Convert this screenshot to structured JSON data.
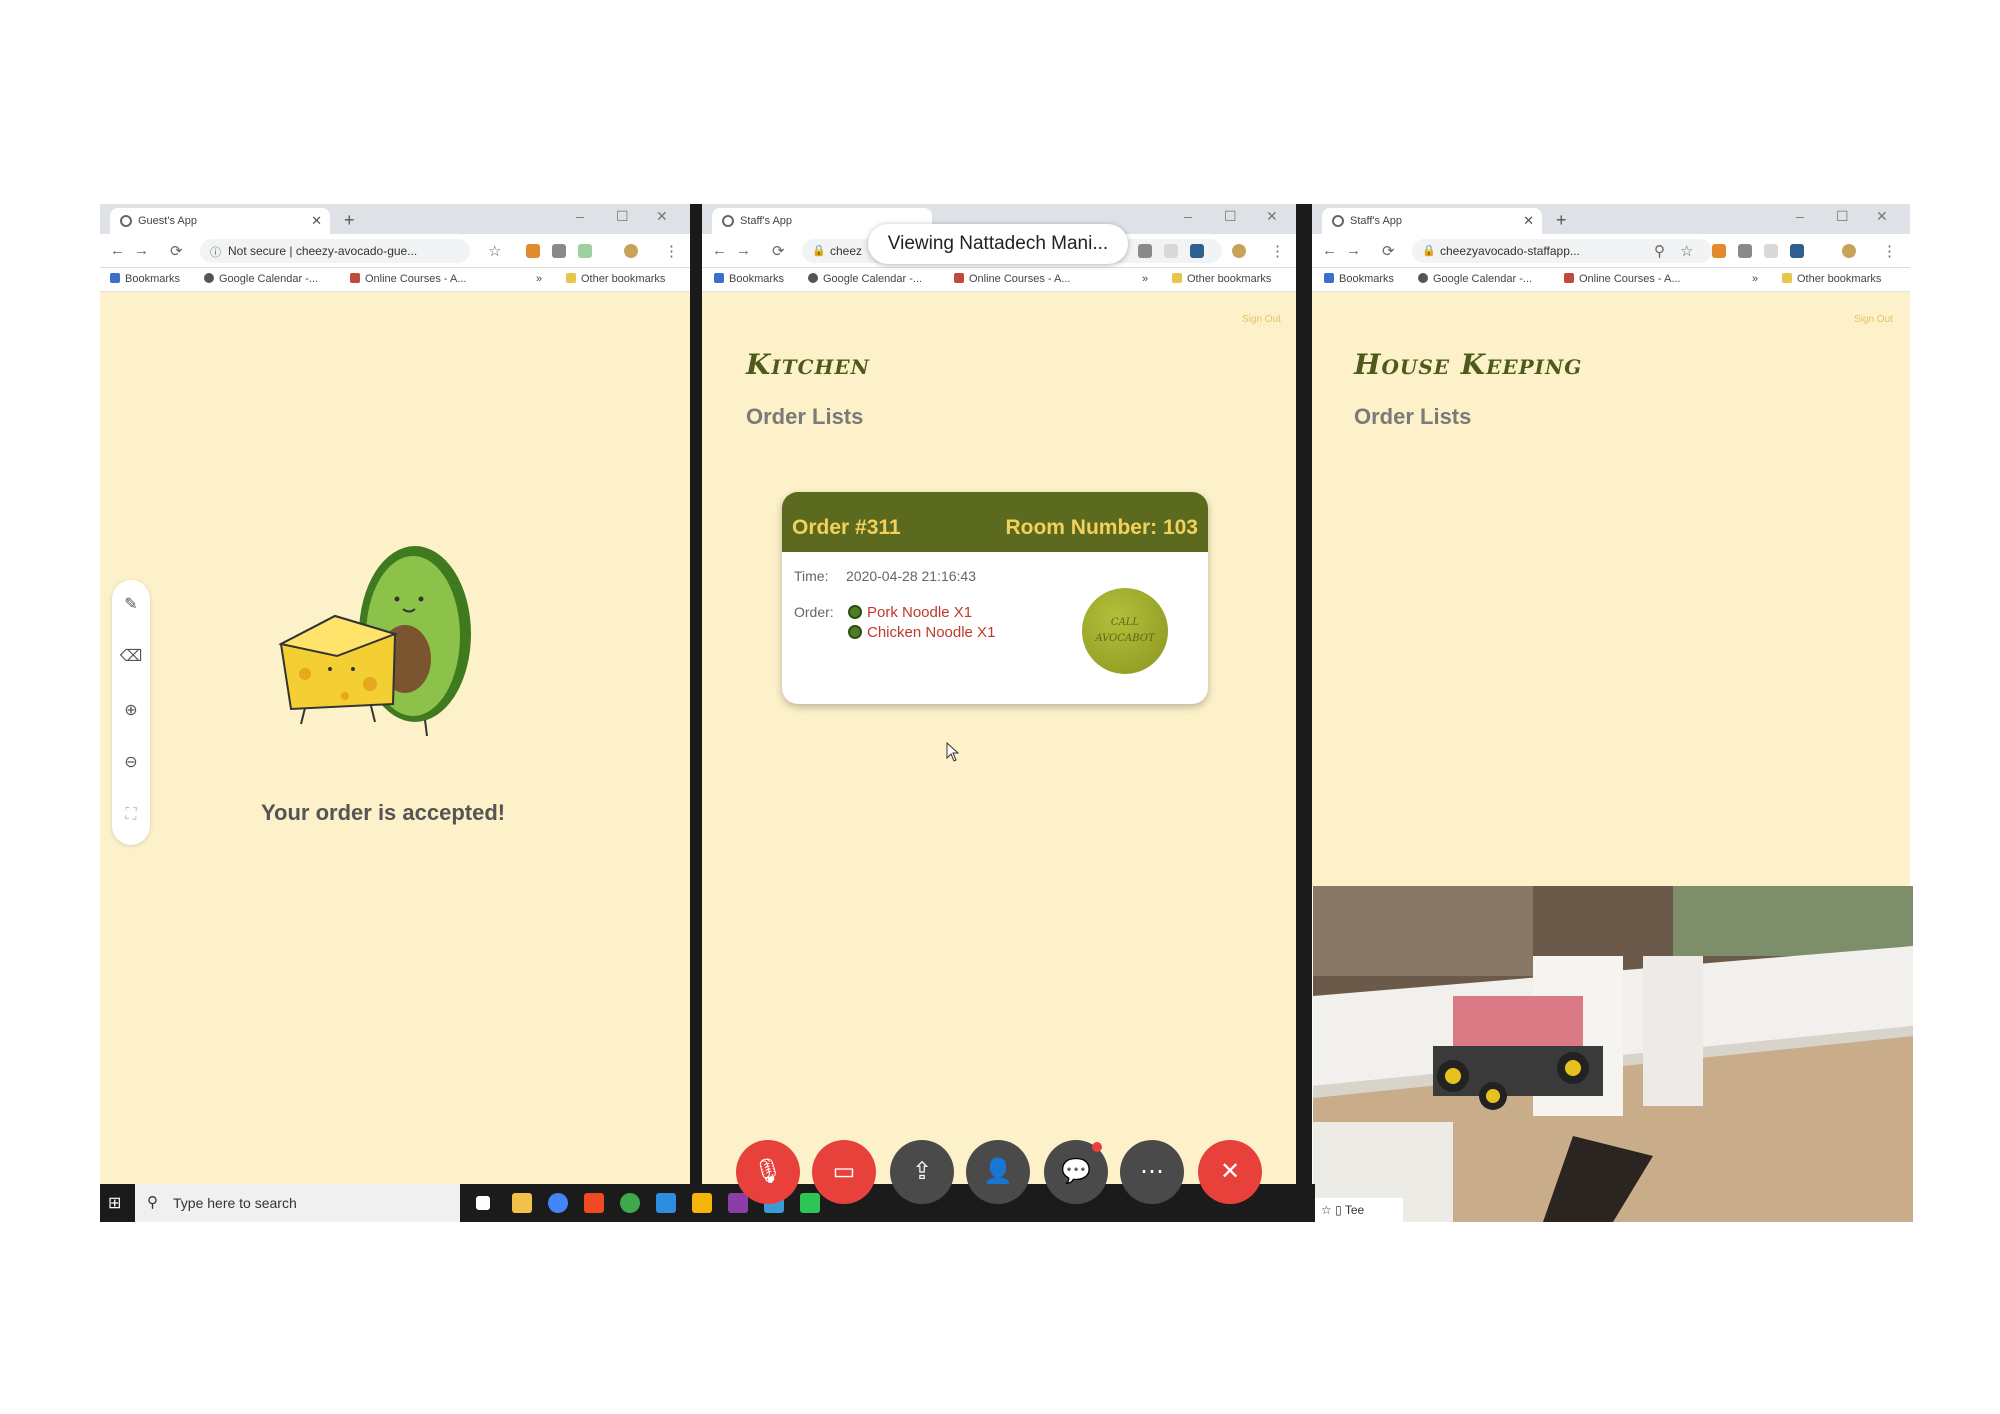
{
  "left_window": {
    "tab_title": "Guest's App",
    "url_prefix": "Not secure",
    "url": "cheezy-avocado-gue...",
    "bookmarks": [
      "Bookmarks",
      "Google Calendar -...",
      "Online Courses - A...",
      "»",
      "Other bookmarks"
    ],
    "message": "Your order is accepted!"
  },
  "middle_window": {
    "tab_title": "Staff's App",
    "url": "cheez",
    "bookmarks": [
      "Bookmarks",
      "Google Calendar -...",
      "Online Courses - A...",
      "»",
      "Other bookmarks"
    ],
    "sign_out": "Sign Out",
    "title": "Kitchen",
    "subtitle": "Order Lists",
    "order": {
      "number": "Order #311",
      "room": "Room Number: 103",
      "time_label": "Time:",
      "time": "2020-04-28 21:16:43",
      "order_label": "Order:",
      "items": [
        "Pork Noodle X1",
        "Chicken Noodle X1"
      ],
      "call_button": [
        "CALL",
        "AVOCABOT"
      ]
    }
  },
  "right_window": {
    "tab_title": "Staff's App",
    "url": "cheezyavocado-staffapp...",
    "bookmarks": [
      "Bookmarks",
      "Google Calendar -...",
      "Online Courses - A...",
      "»",
      "Other bookmarks"
    ],
    "sign_out": "Sign Out",
    "title": "House Keeping",
    "subtitle": "Order Lists",
    "video_label": "Tee"
  },
  "screen_share_banner": "Viewing Nattadech Mani...",
  "taskbar": {
    "search_placeholder": "Type here to search"
  },
  "meeting_controls": [
    "mute-mic",
    "stop-video",
    "share-screen",
    "participants",
    "chat",
    "more",
    "leave"
  ],
  "colors": {
    "page_bg": "#fdf1c9",
    "brand_green": "#5b6a1f",
    "accent_yellow": "#f3d15a",
    "meeting_red": "#e8413c",
    "meeting_grey": "#4a4a4a"
  }
}
